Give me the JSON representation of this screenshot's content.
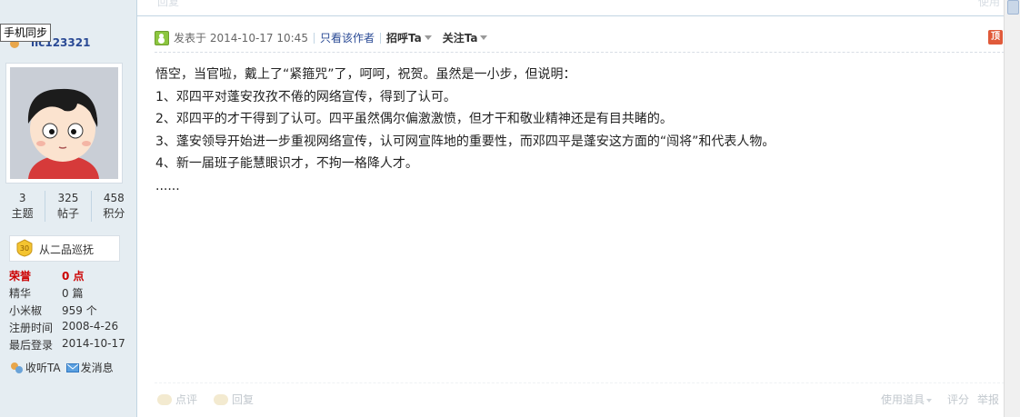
{
  "top": {
    "ghost_reply": "回复",
    "ghost_right": "使用"
  },
  "user": {
    "mobile_sync": "手机同步",
    "username": "llc123321",
    "stats": [
      {
        "num": "3",
        "label": "主题"
      },
      {
        "num": "325",
        "label": "帖子"
      },
      {
        "num": "458",
        "label": "积分"
      }
    ],
    "rank": {
      "badge": "30",
      "title": "从二品巡抚"
    },
    "info": [
      {
        "label": "荣誉",
        "value": "0 点"
      },
      {
        "label": "精华",
        "value": "0 篇"
      },
      {
        "label": "小米椒",
        "value": "959 个"
      },
      {
        "label": "注册时间",
        "value": "2008-4-26"
      },
      {
        "label": "最后登录",
        "value": "2014-10-17"
      }
    ],
    "actions": {
      "follow": "收听TA",
      "message": "发消息"
    }
  },
  "post": {
    "posted_at": "发表于 2014-10-17 10:45",
    "only_author": "只看该作者",
    "greet": "招呼Ta",
    "follow": "关注Ta",
    "report": "顶",
    "lines": [
      "悟空，当官啦，戴上了“紧箍咒”了，呵呵，祝贺。虽然是一小步，但说明：",
      "1、邓四平对蓬安孜孜不倦的网络宣传，得到了认可。",
      "2、邓四平的才干得到了认可。四平虽然偶尔偏激激愤，但才干和敬业精神还是有目共睹的。",
      "3、蓬安领导开始进一步重视网络宣传，认可网宣阵地的重要性，而邓四平是蓬安这方面的“闯将”和代表人物。",
      "4、新一届班子能慧眼识才，不拘一格降人才。",
      "......"
    ],
    "footer": {
      "rate": "点评",
      "reply": "回复",
      "tools": "使用道具",
      "score": "评分",
      "report": "举报"
    }
  },
  "colors": {
    "sidebar_bg": "#e5edf2",
    "link": "#2a4a95",
    "honor": "#cc0000"
  }
}
